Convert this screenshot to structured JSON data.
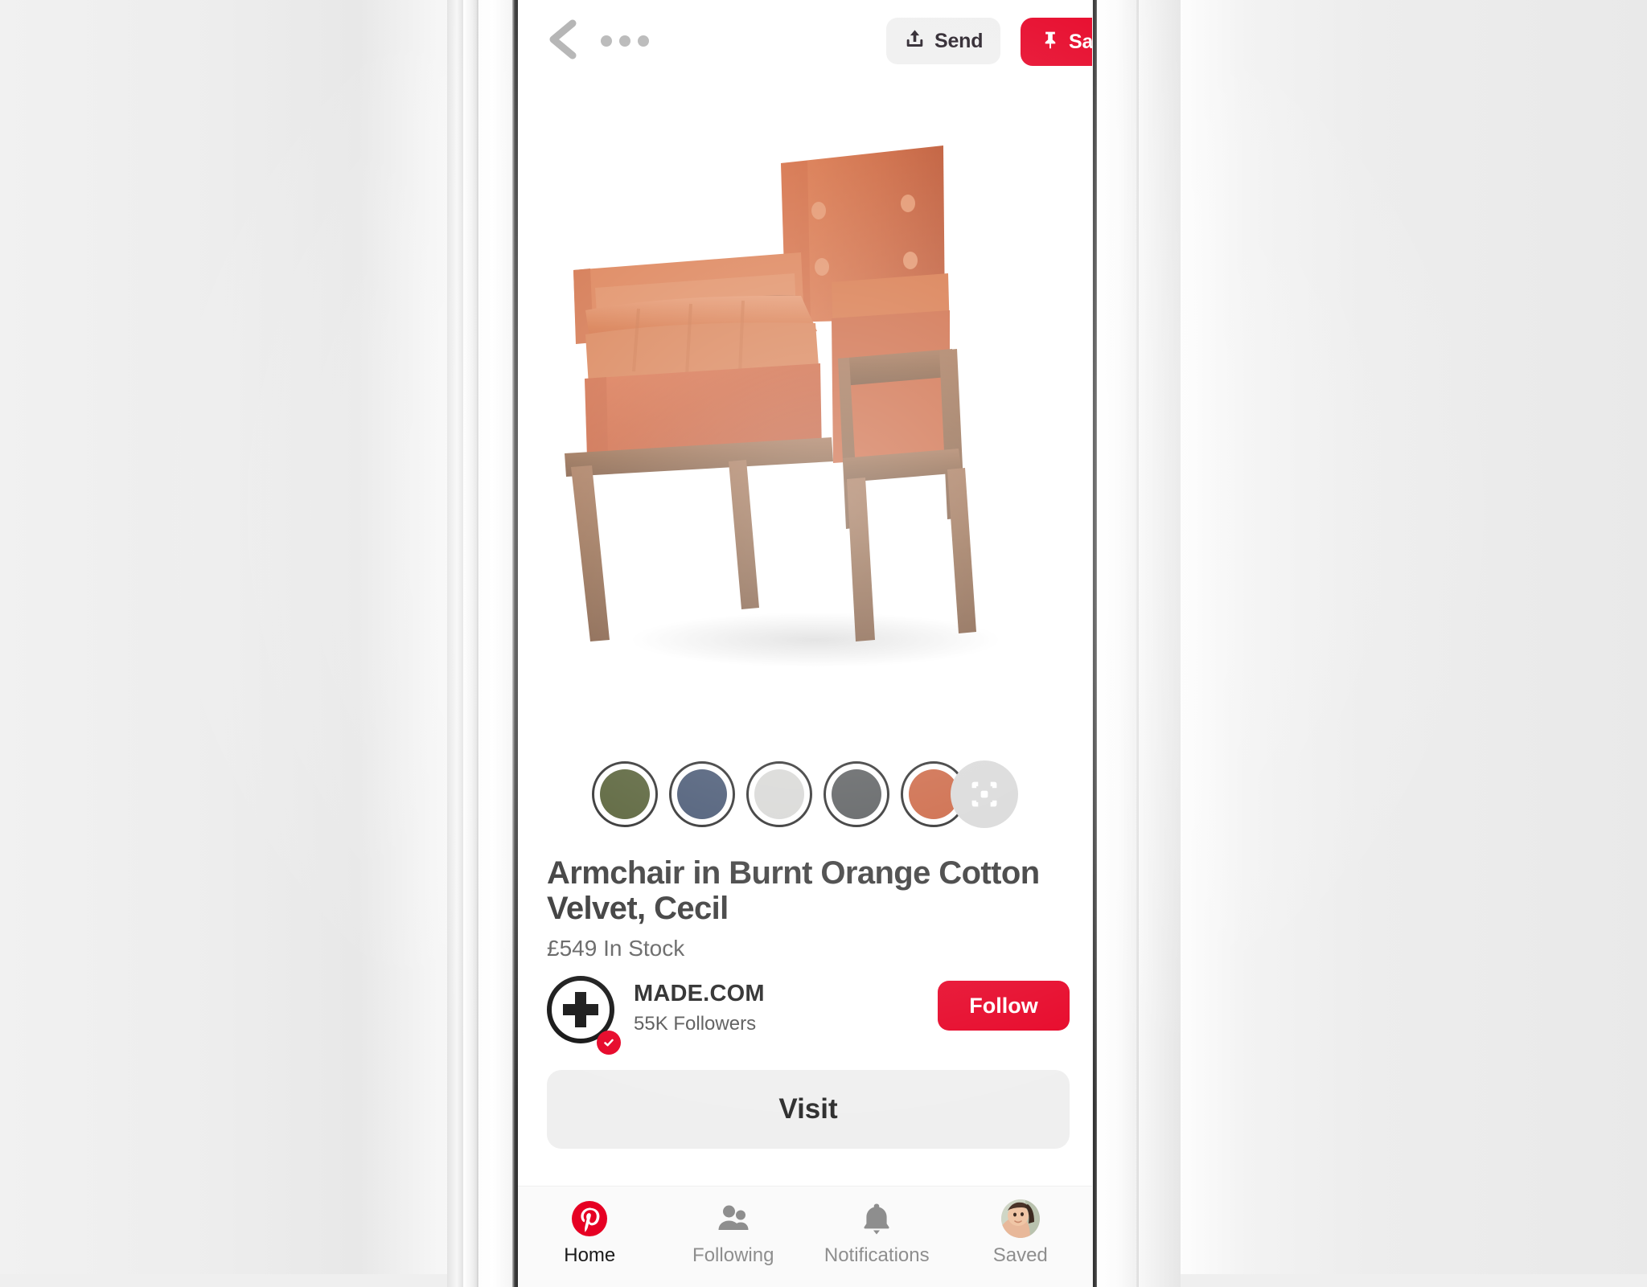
{
  "device": {
    "frame": "smartphone-in-hand-mockup"
  },
  "app": {
    "name": "Pinterest",
    "brand_color": "#e60023"
  },
  "topbar": {
    "back_icon": "chevron-left-icon",
    "more_icon": "ellipsis-icon",
    "send": {
      "label": "Send",
      "icon": "share-upload-icon",
      "bg": "#efefef"
    },
    "save": {
      "label": "Save",
      "icon": "pin-icon",
      "bg": "#e60023"
    }
  },
  "hero": {
    "alt": "Orange velvet armchair with wooden frame",
    "icon": "product-photo",
    "background": "#ffffff",
    "upholstery_color": "#d4612f",
    "wood_color": "#8a5433"
  },
  "swatches": {
    "items": [
      {
        "name": "olive-green",
        "color": "#414c1d"
      },
      {
        "name": "navy-blue",
        "color": "#2e4060"
      },
      {
        "name": "light-grey",
        "color": "#d2d2d0"
      },
      {
        "name": "charcoal",
        "color": "#444749"
      },
      {
        "name": "burnt-orange",
        "color": "#c5512a"
      }
    ],
    "visual_search": {
      "icon": "visual-search-icon",
      "bg": "#d4d4d4"
    }
  },
  "product": {
    "title": "Armchair in Burnt Orange Cotton Velvet, Cecil",
    "price_and_stock": "£549 In Stock",
    "price": "£549",
    "stock": "In Stock"
  },
  "merchant": {
    "avatar_icon": "plus-circle-avatar",
    "verified_icon": "check-badge-icon",
    "name": "MADE.COM",
    "followers": "55K Followers",
    "follow_button": {
      "label": "Follow",
      "bg": "#e60023"
    }
  },
  "visit_button": {
    "label": "Visit",
    "bg": "#efefef"
  },
  "tabbar": {
    "items": [
      {
        "label": "Home",
        "icon": "pinterest-logo-icon",
        "active": true
      },
      {
        "label": "Following",
        "icon": "people-icon",
        "active": false
      },
      {
        "label": "Notifications",
        "icon": "bell-icon",
        "active": false
      },
      {
        "label": "Saved",
        "icon": "user-avatar-photo",
        "active": false
      }
    ]
  }
}
